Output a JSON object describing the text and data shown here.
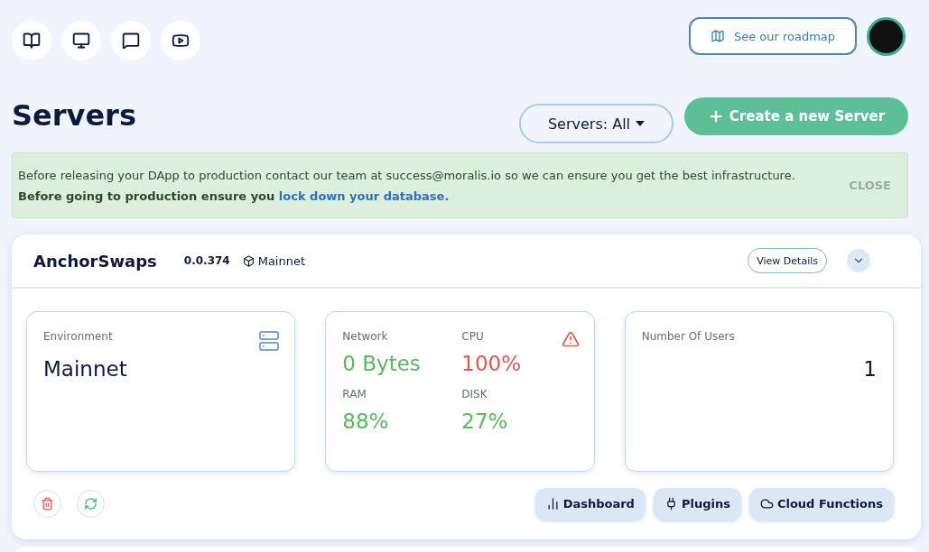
{
  "roadmap_button": "See our roadmap",
  "page_title": "Servers",
  "filter": "Servers: All",
  "create_button": "Create a new Server",
  "notice": {
    "line_1": "Before releasing your DApp to production contact our team at success@moralis.io so we can ensure you get the best infrastructure.",
    "line_2": "Before going to production ensure you",
    "link": "lock down your database.",
    "close": "CLOSE"
  },
  "server": {
    "name": "AnchorSwaps",
    "version": "0.0.374",
    "network": "Mainnet",
    "details_button": "View Details",
    "expanded": false,
    "environment": {
      "label": "Environment",
      "value": "Mainnet"
    },
    "metrics": [
      {
        "label": "Network",
        "value": "0 Bytes",
        "color": "#5cb85c"
      },
      {
        "label": "CPU",
        "value": "100%",
        "color": "#e0574f"
      },
      {
        "label": "RAM",
        "value": "88%",
        "color": "#5cb85c"
      },
      {
        "label": "DISK",
        "value": "27%",
        "color": "#5cb85c"
      }
    ],
    "warning": true,
    "users": {
      "label": "Number Of Users",
      "value": "1"
    },
    "actions": [
      "Dashboard",
      "Plugins",
      "Cloud Functions"
    ]
  }
}
